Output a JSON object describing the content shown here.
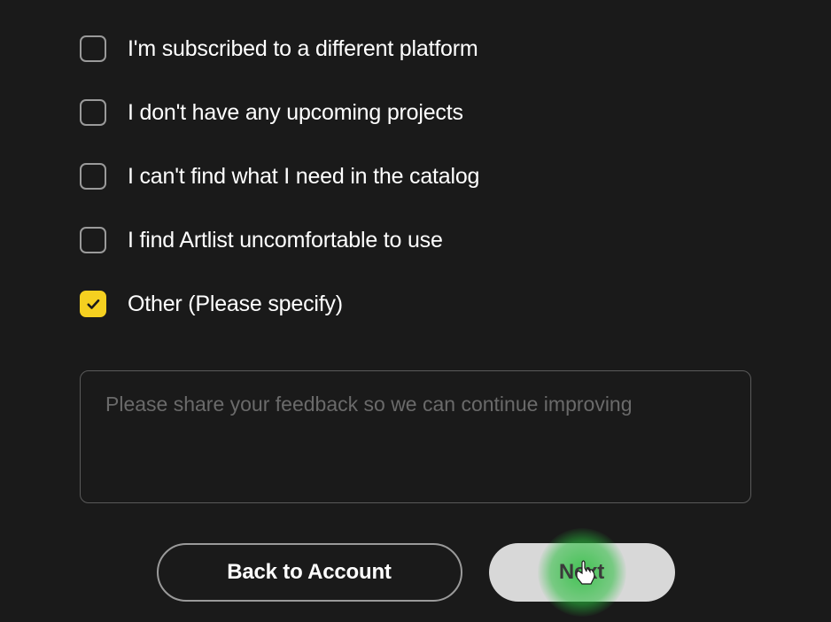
{
  "options": [
    {
      "label": "I'm subscribed to a different platform",
      "checked": false
    },
    {
      "label": "I don't have any upcoming projects",
      "checked": false
    },
    {
      "label": "I can't find what I need in the catalog",
      "checked": false
    },
    {
      "label": "I find Artlist uncomfortable to use",
      "checked": false
    },
    {
      "label": "Other (Please specify)",
      "checked": true
    }
  ],
  "feedback": {
    "placeholder": "Please share your feedback so we can continue improving",
    "value": ""
  },
  "buttons": {
    "back": "Back to Account",
    "next": "Next"
  }
}
